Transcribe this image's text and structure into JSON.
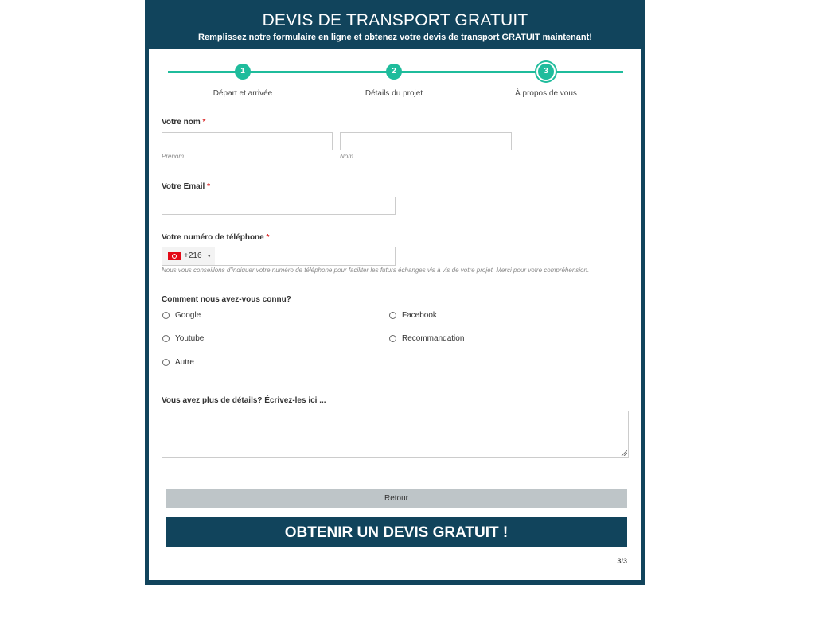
{
  "header": {
    "title": "DEVIS DE TRANSPORT GRATUIT",
    "subtitle": "Remplissez notre formulaire en ligne et obtenez votre devis de transport GRATUIT maintenant!"
  },
  "steps": [
    {
      "number": "1",
      "label": "Départ et arrivée"
    },
    {
      "number": "2",
      "label": "Détails du projet"
    },
    {
      "number": "3",
      "label": "À propos de vous"
    }
  ],
  "colors": {
    "brand": "#11445c",
    "accent": "#1fbc9c",
    "required": "#dd3333"
  },
  "name_field": {
    "label": "Votre nom",
    "required_mark": "*",
    "first_value": "",
    "last_value": "",
    "first_hint": "Prénom",
    "last_hint": "Nom"
  },
  "email_field": {
    "label": "Votre Email",
    "required_mark": "*",
    "value": ""
  },
  "phone_field": {
    "label": "Votre numéro de téléphone",
    "required_mark": "*",
    "country_flag": "tunisia-flag-icon",
    "dial_code": "+216",
    "dropdown_icon": "▾",
    "value": "",
    "hint": "Nous vous conseillons d’indiquer votre numéro de téléphone pour faciliter les futurs échanges vis à vis de votre projet. Merci pour votre compréhension."
  },
  "source_field": {
    "label": "Comment nous avez-vous connu?",
    "options": [
      "Google",
      "Facebook",
      "Youtube",
      "Recommandation",
      "Autre"
    ]
  },
  "details_field": {
    "label": "Vous avez plus de détails? Écrivez-les ici ...",
    "value": ""
  },
  "buttons": {
    "back": "Retour",
    "submit": "OBTENIR UN DEVIS GRATUIT !"
  },
  "pager": "3/3"
}
